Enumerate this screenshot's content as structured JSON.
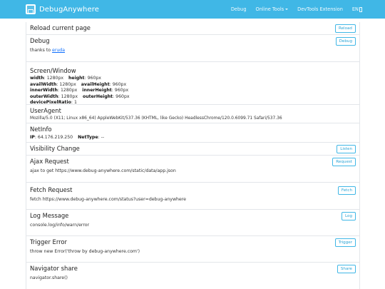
{
  "app": {
    "title": "DebugAnywhere",
    "logo_icon": "window-logo-icon",
    "accent": "#40b7e6"
  },
  "nav": {
    "debug": "Debug",
    "online_tools": "Online Tools",
    "devtools_extension": "DevTools Extension",
    "lang": "EN"
  },
  "cards": {
    "reload": {
      "title": "Reload current page",
      "button": "Reload"
    },
    "debug": {
      "title": "Debug",
      "text_prefix": "thanks to ",
      "link": "eruda",
      "button": "Debug"
    },
    "screen": {
      "title": "Screen/Window",
      "width_label": "width",
      "width_value": ": 1280px",
      "height_label": "height",
      "height_value": ": 960px",
      "availWidth_label": "availWidth",
      "availWidth_value": ": 1280px",
      "availHeight_label": "availHeight",
      "availHeight_value": ": 960px",
      "innerWidth_label": "innerWidth",
      "innerWidth_value": ": 1280px",
      "innerHeight_label": "innerHeight",
      "innerHeight_value": ": 960px",
      "outerWidth_label": "outerWidth",
      "outerWidth_value": ": 1280px",
      "outerHeight_label": "outerHeight",
      "outerHeight_value": ": 960px",
      "dpr_label": "devicePixelRatio",
      "dpr_value": ": 1"
    },
    "useragent": {
      "title": "UserAgent",
      "value": "Mozilla/5.0 (X11; Linux x86_64) AppleWebKit/537.36 (KHTML, like Gecko) HeadlessChrome/120.0.6099.71 Safari/537.36"
    },
    "netinfo": {
      "title": "NetInfo",
      "ip_label": "IP",
      "ip_value": ": 64.176.219.250",
      "nettype_label": "NetType",
      "nettype_value": ": --"
    },
    "visibility": {
      "title": "Visibility Change",
      "button": "Listen"
    },
    "ajax": {
      "title": "Ajax Request",
      "text": "ajax to get https://www.debug-anywhere.com/static/data/app.json",
      "button": "Request"
    },
    "fetch": {
      "title": "Fetch Request",
      "text": "fetch https://www.debug-anywhere.com/status?user=debug-anywhere",
      "button": "Fetch"
    },
    "log": {
      "title": "Log Message",
      "text": "console.log/info/warn/error",
      "button": "Log"
    },
    "trigger": {
      "title": "Trigger Error",
      "text": "throw new Error('throw by debug-anywhere.com')",
      "button": "Trigger"
    },
    "share": {
      "title": "Navigator share",
      "text": "navigator.share()",
      "button": "Share"
    }
  }
}
